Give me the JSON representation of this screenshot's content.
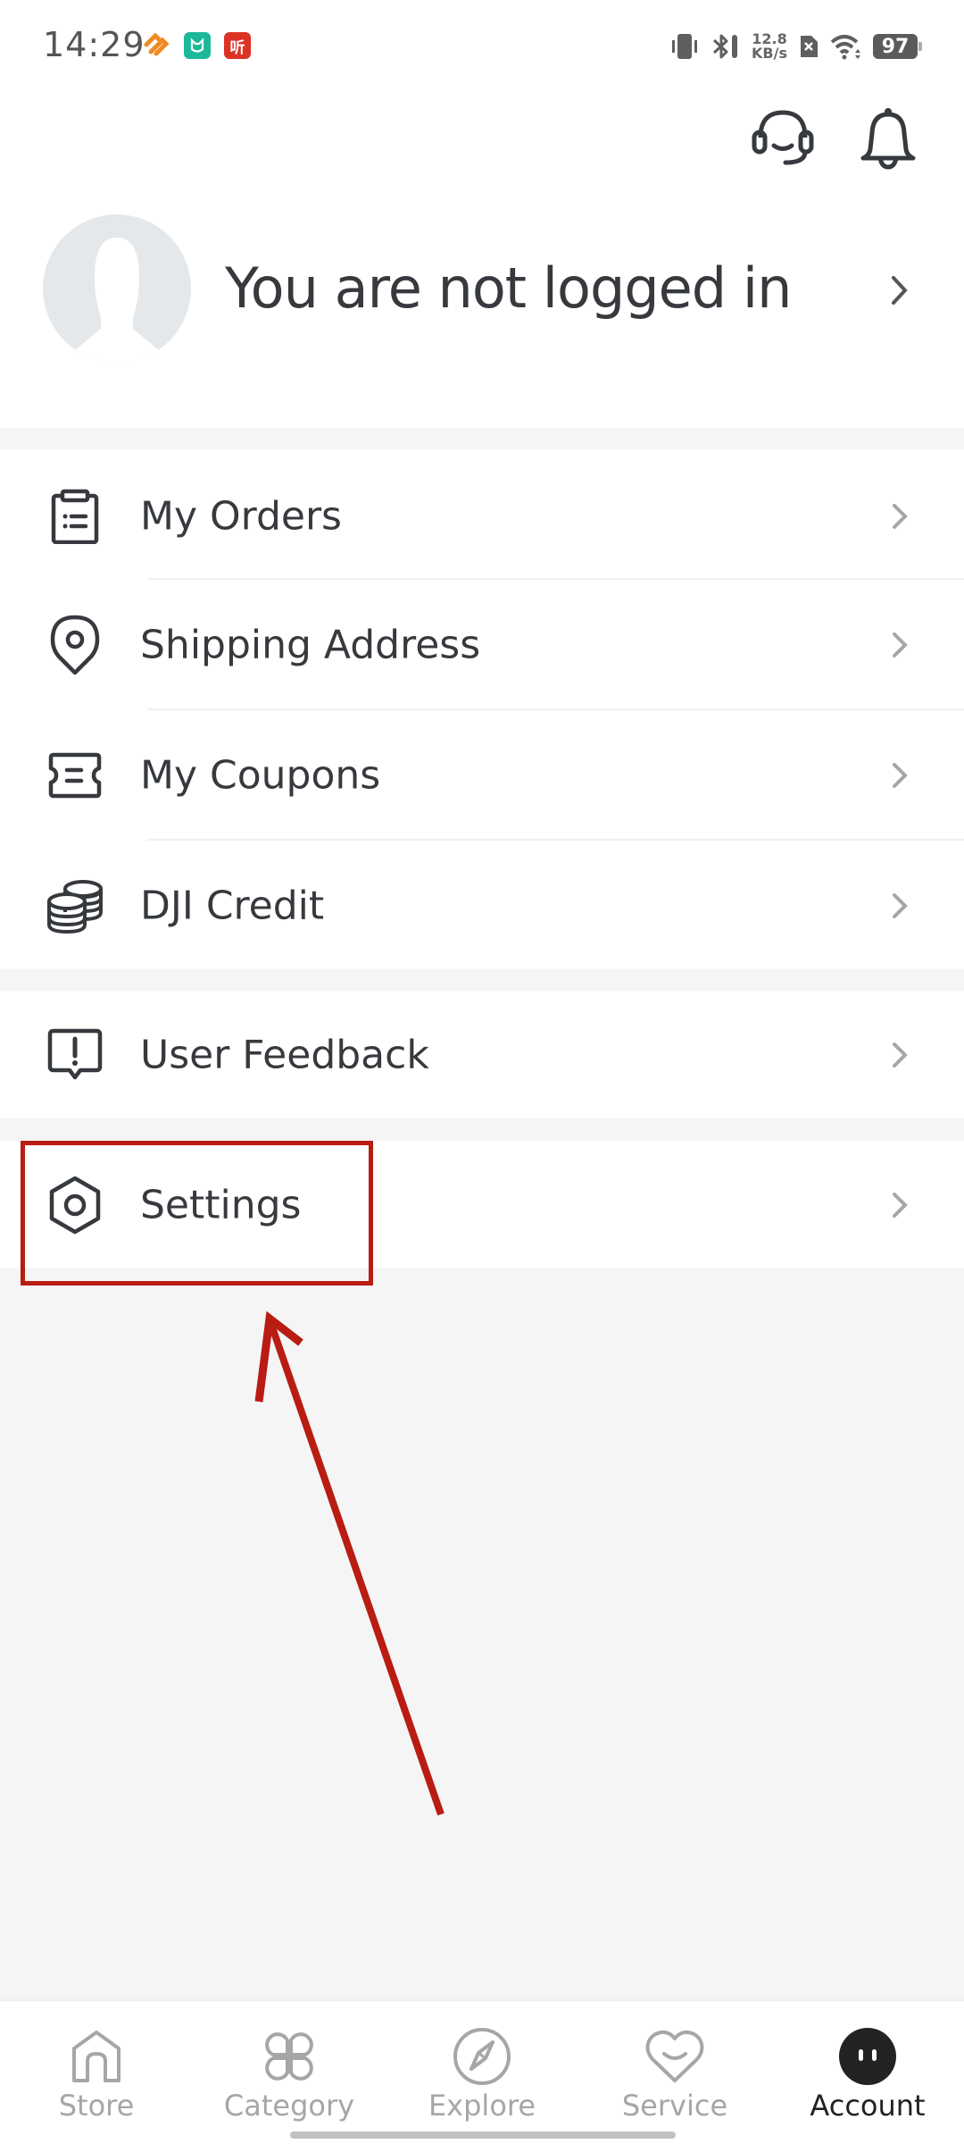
{
  "status_bar": {
    "time": "14:29",
    "notification_icons": [
      "orange-heart-app-icon",
      "mijia-app-icon",
      "ting-app-icon"
    ],
    "ting_glyph": "听",
    "network_speed_value": "12.8",
    "network_speed_unit": "KB/s",
    "battery_level": "97",
    "system_icons": [
      "vibrate-icon",
      "bluetooth-icon",
      "no-sim-icon",
      "wifi-icon",
      "battery-icon"
    ]
  },
  "header": {
    "icons": [
      "headset-support-icon",
      "bell-notification-icon"
    ],
    "profile_text": "You are not logged in"
  },
  "menu": {
    "group1": [
      {
        "label": "My Orders",
        "icon": "clipboard-list-icon"
      },
      {
        "label": "Shipping Address",
        "icon": "location-pin-icon"
      },
      {
        "label": "My Coupons",
        "icon": "coupon-ticket-icon"
      },
      {
        "label": "DJI Credit",
        "icon": "coins-stack-icon"
      }
    ],
    "group2": [
      {
        "label": "User Feedback",
        "icon": "feedback-exclamation-icon"
      }
    ],
    "group3": [
      {
        "label": "Settings",
        "icon": "hexagon-settings-icon"
      }
    ]
  },
  "annotation": {
    "highlight_color": "#b81c12",
    "highlighted_item": "Settings"
  },
  "bottom_nav": {
    "items": [
      {
        "label": "Store",
        "icon": "home-icon",
        "active": false
      },
      {
        "label": "Category",
        "icon": "category-grid-icon",
        "active": false
      },
      {
        "label": "Explore",
        "icon": "compass-icon",
        "active": false
      },
      {
        "label": "Service",
        "icon": "heart-smile-icon",
        "active": false
      },
      {
        "label": "Account",
        "icon": "account-face-icon",
        "active": true
      }
    ]
  },
  "colors": {
    "text": "#36393d",
    "inactive": "#a4a6a8",
    "background": "#f5f5f5",
    "avatar": "#e5e8eb"
  }
}
